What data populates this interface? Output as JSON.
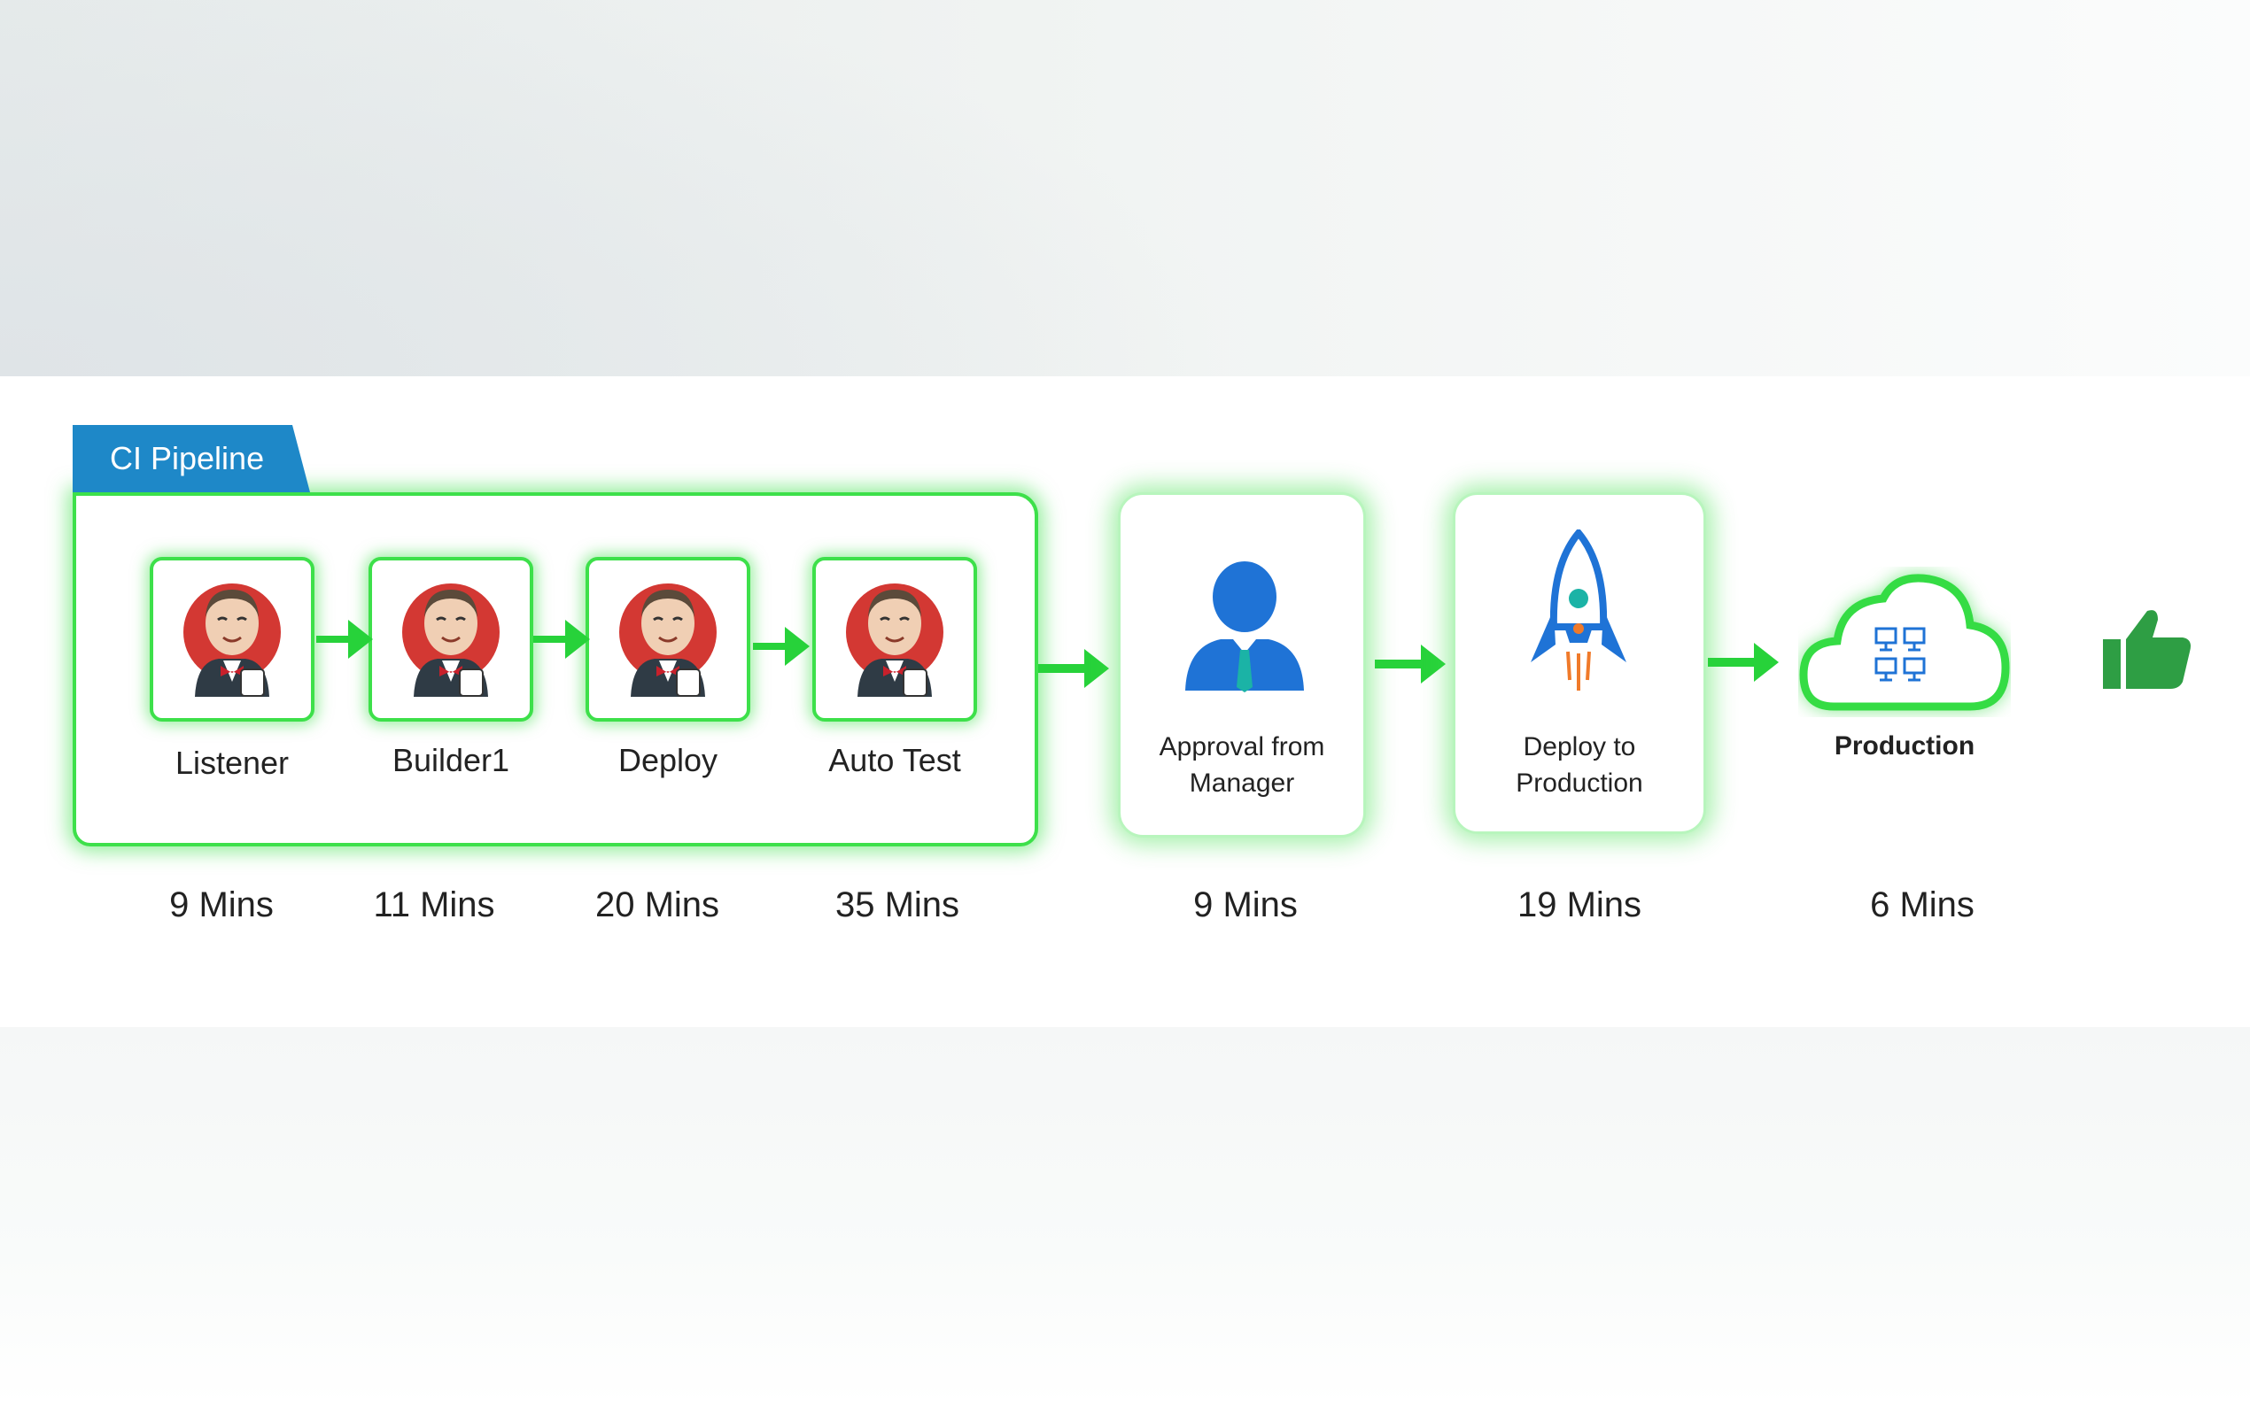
{
  "pipeline": {
    "group_label": "CI Pipeline",
    "jobs": [
      {
        "label": "Listener",
        "time": "9 Mins"
      },
      {
        "label": "Builder1",
        "time": "11 Mins"
      },
      {
        "label": "Deploy",
        "time": "20 Mins"
      },
      {
        "label": "Auto Test",
        "time": "35 Mins"
      }
    ],
    "stages": [
      {
        "label_line1": "Approval from",
        "label_line2": "Manager",
        "time": "9 Mins",
        "icon": "manager-icon"
      },
      {
        "label_line1": "Deploy to",
        "label_line2": "Production",
        "time": "19 Mins",
        "icon": "rocket-icon"
      },
      {
        "label": "Production",
        "time": "6 Mins",
        "icon": "cloud-servers-icon"
      }
    ],
    "final_icon": "thumbs-up-icon"
  },
  "colors": {
    "accent_green": "#3de04a",
    "arrow_green": "#27d23a",
    "tab_blue": "#1e88c8",
    "jenkins_red": "#d33833",
    "person_blue": "#1f73d6",
    "thumb_green": "#2e9e44"
  }
}
